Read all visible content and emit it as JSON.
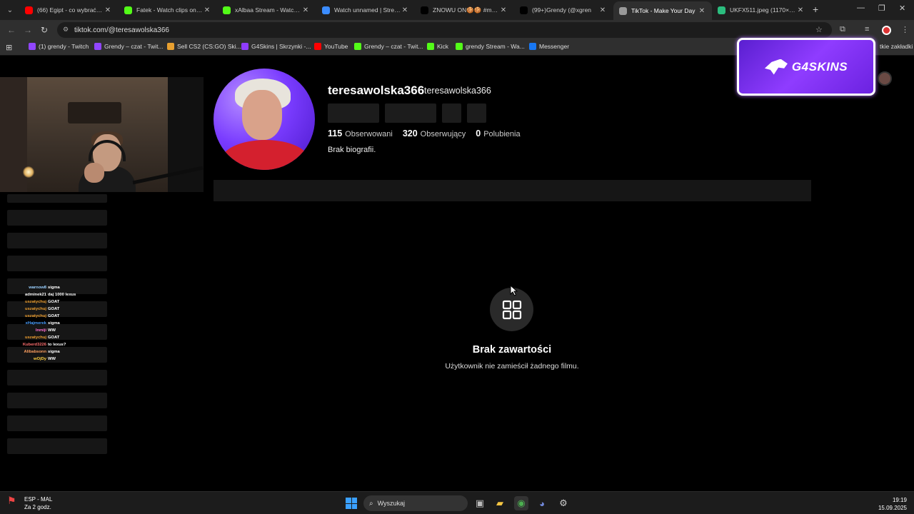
{
  "browser": {
    "tabs": [
      {
        "title": "(66) Egipt - co wybrać. Hu",
        "favicon": "youtube-icon",
        "color": "#ff0000",
        "active": false
      },
      {
        "title": "Fatek - Watch clips on Kic",
        "favicon": "kick-icon",
        "color": "#53fc18",
        "active": false
      },
      {
        "title": "xAlbaa Stream - Watch Liv",
        "favicon": "kick-icon",
        "color": "#53fc18",
        "active": false
      },
      {
        "title": "Watch unnamed | Stream",
        "favicon": "stream-icon",
        "color": "#3b8cff",
        "active": false
      },
      {
        "title": "ZNOWU ON🍪🍪 #maha",
        "favicon": "tiktok-icon",
        "color": "#000000",
        "active": false
      },
      {
        "title": "(99+)Grendy (@xgren",
        "favicon": "tiktok-icon",
        "color": "#000000",
        "active": false
      },
      {
        "title": "TikTok - Make Your Day",
        "favicon": "globe-icon",
        "color": "#999999",
        "active": true
      },
      {
        "title": "UKFX511.jpeg (1170×155",
        "favicon": "image-icon",
        "color": "#2bbd7e",
        "active": false
      }
    ],
    "url": "tiktok.com/@teresawolska366",
    "bookmarks": [
      {
        "label": "(1) grendy - Twitch",
        "favicon": "twitch-icon",
        "color": "#9146ff"
      },
      {
        "label": "Grendy – czat - Twit...",
        "favicon": "twitch-icon",
        "color": "#9146ff"
      },
      {
        "label": "Sell CS2 (CS:GO) Ski...",
        "favicon": "skin-icon",
        "color": "#e8a030"
      },
      {
        "label": "G4Skins | Skrzynki -...",
        "favicon": "g4skins-icon",
        "color": "#8f3cff"
      },
      {
        "label": "YouTube",
        "favicon": "youtube-icon",
        "color": "#ff0000"
      },
      {
        "label": "Grendy – czat - Twit...",
        "favicon": "kick-icon",
        "color": "#53fc18"
      },
      {
        "label": "Kick",
        "favicon": "kick-icon",
        "color": "#53fc18"
      },
      {
        "label": "grendy Stream - Wa...",
        "favicon": "kick-icon",
        "color": "#53fc18"
      },
      {
        "label": "Messenger",
        "favicon": "facebook-icon",
        "color": "#1877f2"
      }
    ],
    "bookmarks_overflow": "tkie zakładki"
  },
  "profile": {
    "username": "teresawolska366",
    "nickname": "teresawolska366",
    "following_count": "115",
    "following_label": "Obserwowani",
    "followers_count": "320",
    "followers_label": "Obserwujący",
    "likes_count": "0",
    "likes_label": "Polubienia",
    "bio": "Brak biografii."
  },
  "empty_state": {
    "title": "Brak zawartości",
    "subtitle": "Użytkownik nie zamieścił żadnego filmu."
  },
  "overlay": {
    "sponsor": "G4SKINS",
    "chat": [
      {
        "user": "warnow8",
        "msg": "sigma",
        "color": "#9ad0ff"
      },
      {
        "user": "adminek21",
        "msg": "daj 1000 lexus",
        "color": "#ffffff"
      },
      {
        "user": "uszatychuj",
        "msg": "GOAT",
        "color": "#f0a030"
      },
      {
        "user": "uszatychuj",
        "msg": "GOAT",
        "color": "#f0a030"
      },
      {
        "user": "uszatychuj",
        "msg": "GOAT",
        "color": "#f0a030"
      },
      {
        "user": "xHajmerek",
        "msg": "sigma",
        "color": "#4aa0ff"
      },
      {
        "user": "Inmiji",
        "msg": "WW",
        "color": "#ff6fd0"
      },
      {
        "user": "uszatychuj",
        "msg": "GOAT",
        "color": "#f0a030"
      },
      {
        "user": "Kuberd3226",
        "msg": "to lexus?",
        "color": "#ff7070"
      },
      {
        "user": "Alibabsonn",
        "msg": "sigma",
        "color": "#ffa060"
      },
      {
        "user": "wOjDy",
        "msg": "WW",
        "color": "#ffd040"
      }
    ]
  },
  "taskbar": {
    "weather_title": "ESP - MAL",
    "weather_sub": "Za 2 godz.",
    "search_placeholder": "Wyszukaj",
    "time": "19:19",
    "date": "15.09.2025"
  }
}
